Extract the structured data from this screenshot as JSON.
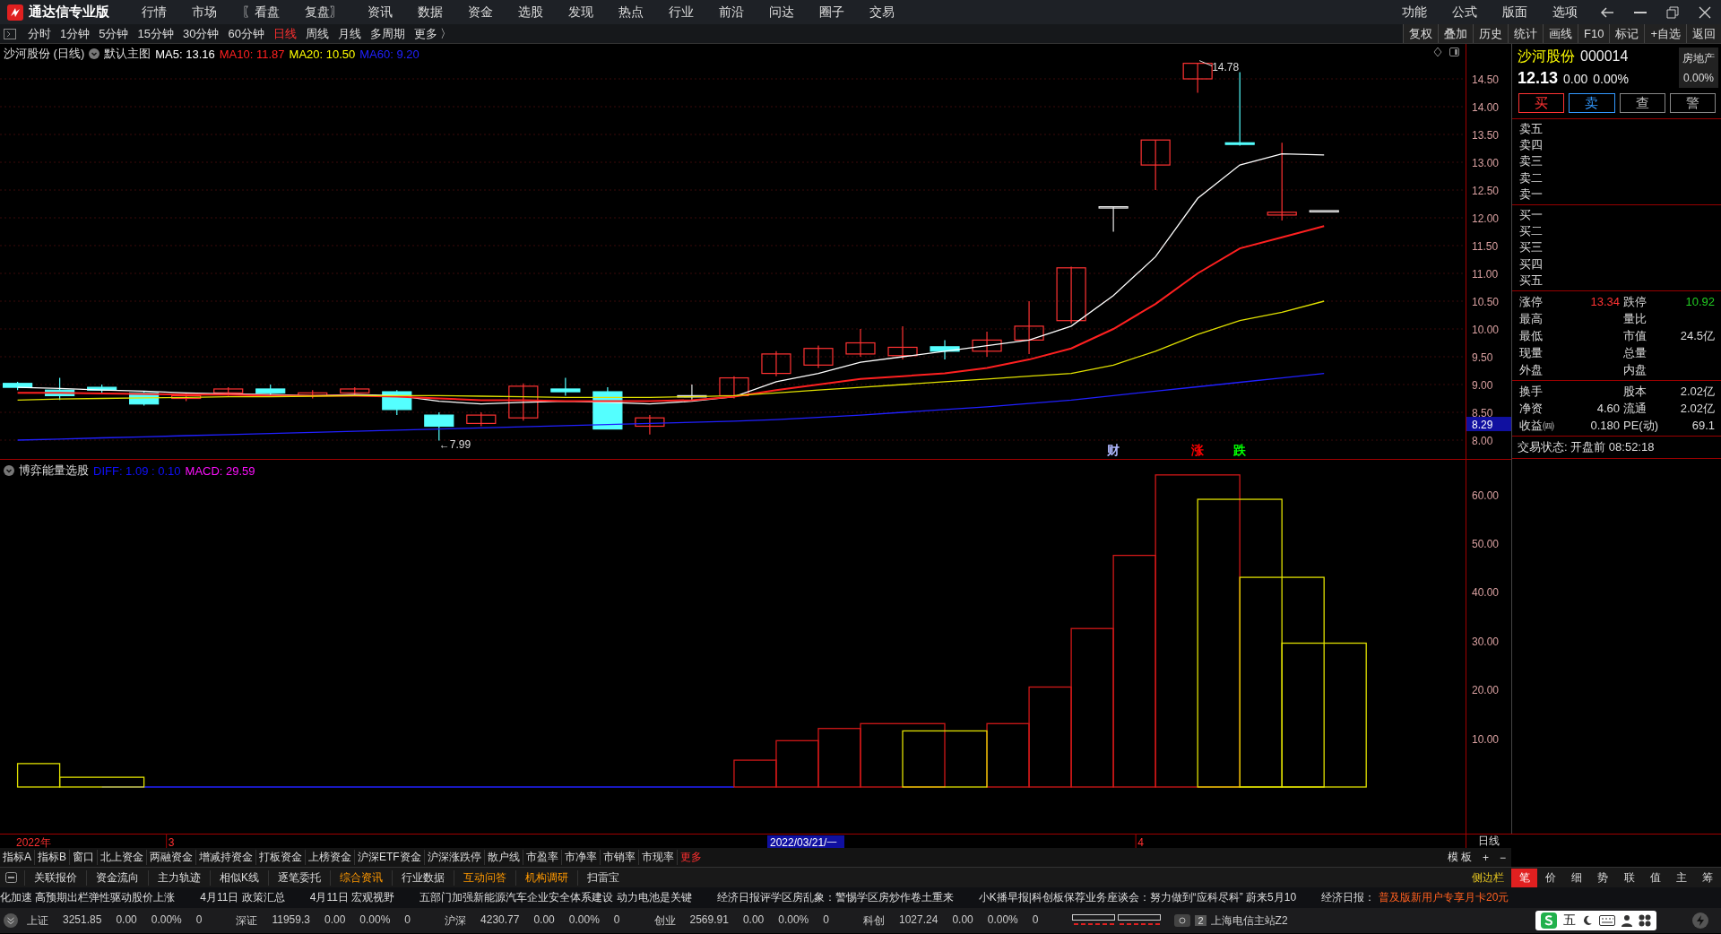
{
  "app": {
    "title": "通达信专业版"
  },
  "menu": [
    "行情",
    "市场",
    "〖看盘",
    "复盘〗",
    "资讯",
    "数据",
    "资金",
    "选股",
    "发现",
    "热点",
    "行业",
    "前沿",
    "问达",
    "圈子",
    "交易"
  ],
  "menu_right": [
    "功能",
    "公式",
    "版面",
    "选项"
  ],
  "periods": [
    {
      "label": "分时",
      "selected": false
    },
    {
      "label": "1分钟",
      "selected": false
    },
    {
      "label": "5分钟",
      "selected": false
    },
    {
      "label": "15分钟",
      "selected": false
    },
    {
      "label": "30分钟",
      "selected": false
    },
    {
      "label": "60分钟",
      "selected": false
    },
    {
      "label": "日线",
      "selected": true
    },
    {
      "label": "周线",
      "selected": false
    },
    {
      "label": "月线",
      "selected": false
    },
    {
      "label": "多周期",
      "selected": false
    },
    {
      "label": "更多 〉",
      "selected": false
    }
  ],
  "tools": [
    "复权",
    "叠加",
    "历史",
    "统计",
    "画线",
    "F10",
    "标记",
    "+自选",
    "返回"
  ],
  "main_chart": {
    "title": "沙河股份 (日线)",
    "template": "默认主图",
    "indicators": [
      {
        "text": "MA5: 13.16",
        "color": "#ffffff"
      },
      {
        "text": "MA10: 11.87",
        "color": "#ff2020"
      },
      {
        "text": "MA20: 10.50",
        "color": "#ffff00"
      },
      {
        "text": "MA60: 9.20",
        "color": "#2020ff"
      }
    ],
    "price_axis": [
      "14.50",
      "14.00",
      "13.50",
      "13.00",
      "12.50",
      "12.00",
      "11.50",
      "11.00",
      "10.50",
      "10.00",
      "9.50",
      "9.00",
      "8.50",
      "8.00"
    ],
    "cursor_price": "8.29",
    "time_labels": [
      "2022年",
      "3",
      "4"
    ],
    "markers": [
      "14.78",
      "←7.99"
    ],
    "events": [
      {
        "text": "财",
        "color": "#b0b8ff"
      },
      {
        "text": "涨",
        "color": "#ff0000"
      },
      {
        "text": "跌",
        "color": "#00ff00"
      }
    ]
  },
  "sub_chart": {
    "title": "博弈能量选股",
    "indicators": [
      {
        "text": "DIFF: 1.09 : 0.10",
        "color": "#1010ff"
      },
      {
        "text": "MACD: 29.59",
        "color": "#ff10ff"
      }
    ],
    "value_axis": [
      "60.00",
      "50.00",
      "40.00",
      "30.00",
      "20.00",
      "10.00"
    ]
  },
  "time_axis": {
    "cursor_date": "2022/03/21/一",
    "period": "日线"
  },
  "quote": {
    "name": "沙河股份",
    "code": "000014",
    "price": "12.13",
    "change": "0.00",
    "pct": "0.00%",
    "sector": "房地产",
    "sector_pct": "0.00%",
    "actions": [
      {
        "label": "买",
        "kind": "buy"
      },
      {
        "label": "卖",
        "kind": "sell"
      },
      {
        "label": "查",
        "kind": "plain"
      },
      {
        "label": "警",
        "kind": "plain"
      }
    ]
  },
  "asks": [
    "卖五",
    "卖四",
    "卖三",
    "卖二",
    "卖一"
  ],
  "bids": [
    "买一",
    "买二",
    "买三",
    "买四",
    "买五"
  ],
  "stats": [
    [
      {
        "label": "涨停",
        "value": "13.34",
        "color": "#ff3333"
      },
      {
        "label": "跌停",
        "value": "10.92",
        "color": "#22cc22"
      }
    ],
    [
      {
        "label": "最高"
      },
      {
        "label": "量比"
      }
    ],
    [
      {
        "label": "最低"
      },
      {
        "label": "市值",
        "value": "24.5亿"
      }
    ],
    [
      {
        "label": "现量"
      },
      {
        "label": "总量"
      }
    ],
    [
      {
        "label": "外盘"
      },
      {
        "label": "内盘"
      }
    ]
  ],
  "stats2": [
    [
      {
        "label": "换手"
      },
      {
        "label": "股本",
        "value": "2.02亿"
      }
    ],
    [
      {
        "label": "净资",
        "value": "4.60"
      },
      {
        "label": "流通",
        "value": "2.02亿"
      }
    ],
    [
      {
        "label": "收益㈣",
        "value": "0.180"
      },
      {
        "label": "PE(动)",
        "value": "69.1"
      }
    ]
  ],
  "trade_status": "交易状态: 开盘前 08:52:18",
  "indicator_tabs": [
    "指标A",
    "指标B",
    "窗口",
    "北上资金",
    "两融资金",
    "增减持资金",
    "打板资金",
    "上榜资金",
    "沪深ETF资金",
    "沪深涨跌停",
    "散户线",
    "市盈率",
    "市净率",
    "市销率",
    "市现率"
  ],
  "indicator_more": "更多",
  "template_controls": [
    "模 板",
    "+",
    "−"
  ],
  "info_tabs": [
    {
      "label": "关联报价",
      "highlight": false
    },
    {
      "label": "资金流向",
      "highlight": false
    },
    {
      "label": "主力轨迹",
      "highlight": false
    },
    {
      "label": "相似K线",
      "highlight": false
    },
    {
      "label": "逐笔委托",
      "highlight": false
    },
    {
      "label": "综合资讯",
      "highlight": true
    },
    {
      "label": "行业数据",
      "highlight": false
    },
    {
      "label": "互动问答",
      "highlight": true
    },
    {
      "label": "机构调研",
      "highlight": true
    },
    {
      "label": "扫雷宝",
      "highlight": false
    }
  ],
  "sidebar_toggle": "侧边栏",
  "panel_tabs": [
    {
      "label": "笔",
      "selected": true
    },
    {
      "label": "价",
      "selected": false
    },
    {
      "label": "细",
      "selected": false
    },
    {
      "label": "势",
      "selected": false
    },
    {
      "label": "联",
      "selected": false
    },
    {
      "label": "值",
      "selected": false
    },
    {
      "label": "主",
      "selected": false
    },
    {
      "label": "筹",
      "selected": false
    }
  ],
  "ticker": [
    "化加速 高预期出栏弹性驱动股价上涨",
    "4月11日 政策汇总",
    "4月11日 宏观视野",
    "五部门加强新能源汽车企业安全体系建设 动力电池是关键",
    "经济日报评学区房乱象：警惕学区房炒作卷土重来",
    "小K播早报|科创板保荐业务座谈会：努力做到“应科尽科” 蔚来5月10",
    "经济日报：",
    "普及版新用户专享月卡20元"
  ],
  "indices": [
    {
      "name": "上证",
      "value": "3251.85",
      "change": "0.00",
      "pct": "0.00%",
      "volume": "0"
    },
    {
      "name": "深证",
      "value": "11959.3",
      "change": "0.00",
      "pct": "0.00%",
      "volume": "0"
    },
    {
      "name": "沪深",
      "value": "4230.77",
      "change": "0.00",
      "pct": "0.00%",
      "volume": "0"
    },
    {
      "name": "创业",
      "value": "2569.91",
      "change": "0.00",
      "pct": "0.00%",
      "volume": "0"
    },
    {
      "name": "科创",
      "value": "1027.24",
      "change": "0.00",
      "pct": "0.00%",
      "volume": "0"
    }
  ],
  "server": {
    "badge": "2",
    "name": "上海电信主站Z2"
  },
  "ime": {
    "label": "五"
  }
}
